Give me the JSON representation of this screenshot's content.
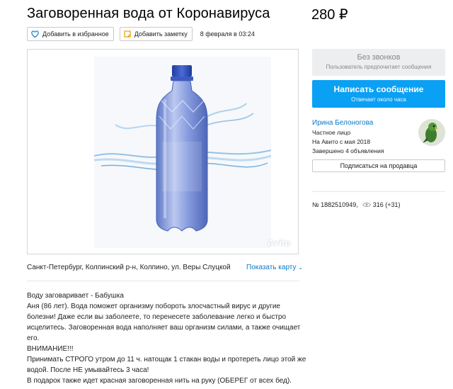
{
  "listing": {
    "title": "Заговоренная вода от Коронавируса",
    "price": "280 ₽",
    "favorite_label": "Добавить в избранное",
    "note_label": "Добавить заметку",
    "date": "8 февраля в 03:24",
    "watermark": "Avito",
    "address": "Санкт-Петербург, Колпинский р-н, Колпино, ул. Веры Слуцкой",
    "show_map_label": "Показать карту"
  },
  "description": {
    "lines": [
      "Воду заговаривает - Бабушка",
      "Аня (86 лет). Вода поможет организму побороть злосчастный вирус и другие",
      "болезни! Даже если вы заболеете, то перенесете заболевание легко и быстро",
      "исцелитесь. Заговоренная вода наполняет ваш организм силами, а также очищает",
      "его.",
      "ВНИМАНИЕ!!!",
      "Принимать СТРОГО утром до 11 ч. натощак 1 стакан воды и протереть лицо этой же",
      "водой. После НЕ умывайтесь 3 часа!",
      "В подарок также идет красная заговоренная нить на руку (ОБЕРЕГ от всех бед)."
    ]
  },
  "sidebar": {
    "no_calls_title": "Без звонков",
    "no_calls_sub": "Пользователь предпочитает сообщения",
    "message_title": "Написать сообщение",
    "message_sub": "Отвечает около часа"
  },
  "seller": {
    "name": "Ирина Белоногова",
    "type": "Частное лицо",
    "since": "На Авито с мая 2018",
    "completed": "Завершено 4 объявления",
    "subscribe_label": "Подписаться на продавца"
  },
  "meta": {
    "number": "№ 1882510949,",
    "views": "316 (+31)"
  },
  "colors": {
    "accent": "#0aa0f3",
    "link": "#0a7ac5",
    "button_gray": "#eceef0"
  }
}
